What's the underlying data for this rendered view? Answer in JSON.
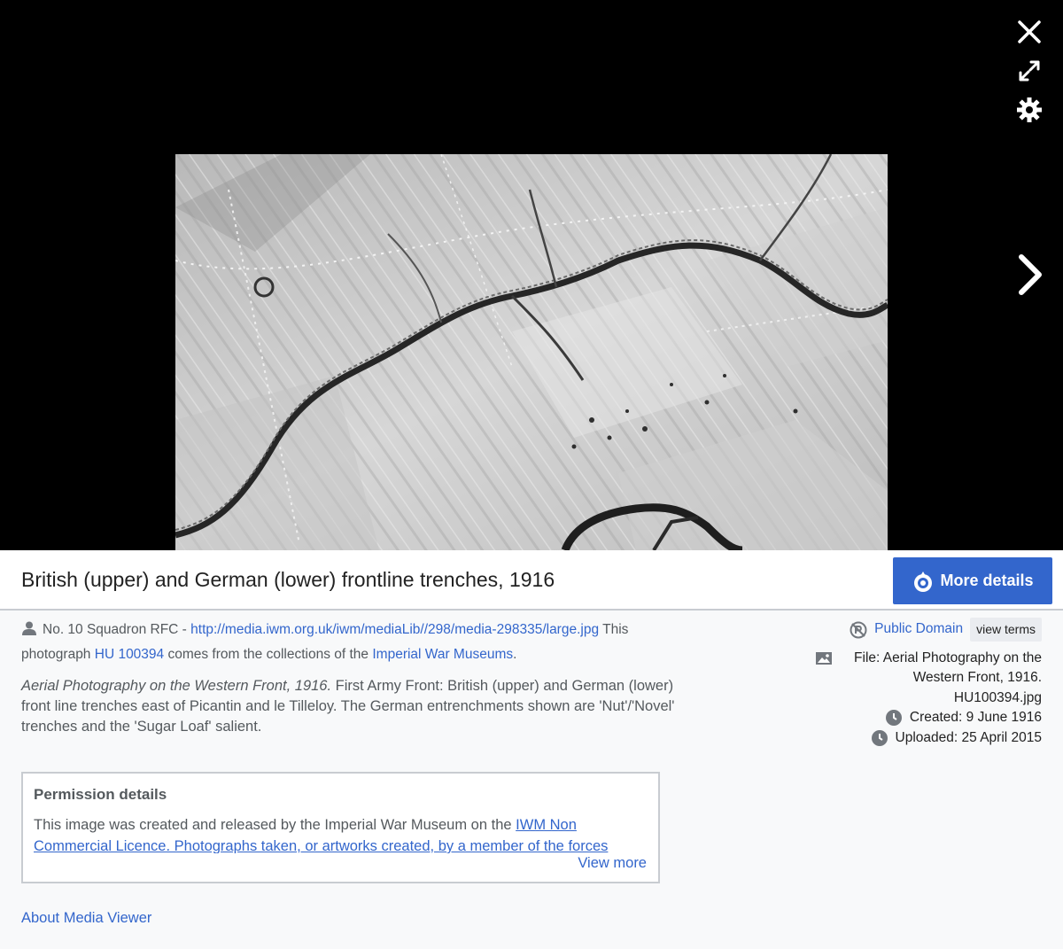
{
  "title": "British (upper) and German (lower) frontline trenches, 1916",
  "more_details_label": "More details",
  "author": {
    "name": "No. 10 Squadron RFC",
    "sep": " - ",
    "url": "http://media.iwm.org.uk/iwm/mediaLib//298/media-298335/large.jpg",
    "t1": " This photograph ",
    "catalog": "HU 100394",
    "t2": " comes from the collections of the ",
    "museum": "Imperial War Museums",
    "t3": "."
  },
  "description": {
    "italic": "Aerial Photography on the Western Front, 1916.",
    "text": " First Army Front: British (upper) and German (lower) front line trenches east of Picantin and le Tilleloy. The German entrenchments shown are 'Nut'/'Novel' trenches and the 'Sugar Loaf' salient."
  },
  "permission": {
    "title": "Permission details",
    "t1": "This image was created and released by the Imperial War Museum on the ",
    "link": "IWM Non Commercial Licence",
    "t2": ". Photographs taken, or artworks created, by a member of the forces",
    "view_more": "View more"
  },
  "about": "About Media Viewer",
  "license": {
    "name": "Public Domain",
    "terms": "view terms"
  },
  "file": "File: Aerial Photography on the Western Front, 1916. HU100394.jpg",
  "created": "Created: 9 June 1916",
  "uploaded": "Uploaded: 25 April 2015",
  "icons": [
    "close-icon",
    "fullscreen-icon",
    "gear-icon",
    "next-arrow-icon",
    "person-icon",
    "public-domain-icon",
    "image-file-icon",
    "clock-icon"
  ]
}
